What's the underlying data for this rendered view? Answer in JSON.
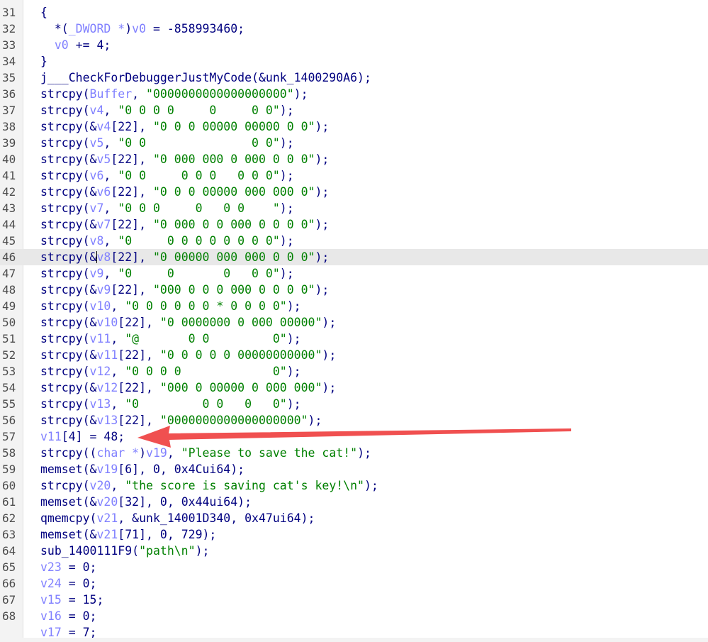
{
  "editor": {
    "highlight_line": 46,
    "caret_line": 46,
    "caret_col": 8,
    "lines": [
      {
        "n": "31",
        "t": [
          {
            "c": "punc",
            "s": "{"
          }
        ]
      },
      {
        "n": "32",
        "t": [
          {
            "c": "plain",
            "s": "  *("
          },
          {
            "c": "type",
            "s": "_DWORD *"
          },
          {
            "c": "plain",
            "s": ")"
          },
          {
            "c": "var",
            "s": "v0"
          },
          {
            "c": "plain",
            "s": " = -858993460;"
          }
        ]
      },
      {
        "n": "33",
        "t": [
          {
            "c": "var",
            "s": "  v0"
          },
          {
            "c": "plain",
            "s": " += 4;"
          }
        ]
      },
      {
        "n": "34",
        "t": [
          {
            "c": "punc",
            "s": "}"
          }
        ]
      },
      {
        "n": "35",
        "t": [
          {
            "c": "fn",
            "s": "j___CheckForDebuggerJustMyCode"
          },
          {
            "c": "plain",
            "s": "(&unk_1400290A6);"
          }
        ]
      },
      {
        "n": "36",
        "t": [
          {
            "c": "fn",
            "s": "strcpy"
          },
          {
            "c": "plain",
            "s": "("
          },
          {
            "c": "var",
            "s": "Buffer"
          },
          {
            "c": "plain",
            "s": ", "
          },
          {
            "c": "str",
            "s": "\"0000000000000000000\""
          },
          {
            "c": "plain",
            "s": ");"
          }
        ]
      },
      {
        "n": "37",
        "t": [
          {
            "c": "fn",
            "s": "strcpy"
          },
          {
            "c": "plain",
            "s": "("
          },
          {
            "c": "var",
            "s": "v4"
          },
          {
            "c": "plain",
            "s": ", "
          },
          {
            "c": "str",
            "s": "\"0 0 0 0     0     0 0\""
          },
          {
            "c": "plain",
            "s": ");"
          }
        ]
      },
      {
        "n": "38",
        "t": [
          {
            "c": "fn",
            "s": "strcpy"
          },
          {
            "c": "plain",
            "s": "(&"
          },
          {
            "c": "var",
            "s": "v4"
          },
          {
            "c": "plain",
            "s": "[22], "
          },
          {
            "c": "str",
            "s": "\"0 0 0 00000 00000 0 0\""
          },
          {
            "c": "plain",
            "s": ");"
          }
        ]
      },
      {
        "n": "39",
        "t": [
          {
            "c": "fn",
            "s": "strcpy"
          },
          {
            "c": "plain",
            "s": "("
          },
          {
            "c": "var",
            "s": "v5"
          },
          {
            "c": "plain",
            "s": ", "
          },
          {
            "c": "str",
            "s": "\"0 0               0 0\""
          },
          {
            "c": "plain",
            "s": ");"
          }
        ]
      },
      {
        "n": "40",
        "t": [
          {
            "c": "fn",
            "s": "strcpy"
          },
          {
            "c": "plain",
            "s": "(&"
          },
          {
            "c": "var",
            "s": "v5"
          },
          {
            "c": "plain",
            "s": "[22], "
          },
          {
            "c": "str",
            "s": "\"0 000 000 0 000 0 0 0\""
          },
          {
            "c": "plain",
            "s": ");"
          }
        ]
      },
      {
        "n": "41",
        "t": [
          {
            "c": "fn",
            "s": "strcpy"
          },
          {
            "c": "plain",
            "s": "("
          },
          {
            "c": "var",
            "s": "v6"
          },
          {
            "c": "plain",
            "s": ", "
          },
          {
            "c": "str",
            "s": "\"0 0     0 0 0   0 0 0\""
          },
          {
            "c": "plain",
            "s": ");"
          }
        ]
      },
      {
        "n": "42",
        "t": [
          {
            "c": "fn",
            "s": "strcpy"
          },
          {
            "c": "plain",
            "s": "(&"
          },
          {
            "c": "var",
            "s": "v6"
          },
          {
            "c": "plain",
            "s": "[22], "
          },
          {
            "c": "str",
            "s": "\"0 0 0 00000 000 000 0\""
          },
          {
            "c": "plain",
            "s": ");"
          }
        ]
      },
      {
        "n": "43",
        "t": [
          {
            "c": "fn",
            "s": "strcpy"
          },
          {
            "c": "plain",
            "s": "("
          },
          {
            "c": "var",
            "s": "v7"
          },
          {
            "c": "plain",
            "s": ", "
          },
          {
            "c": "str",
            "s": "\"0 0 0     0   0 0    \""
          },
          {
            "c": "plain",
            "s": ");"
          }
        ]
      },
      {
        "n": "44",
        "t": [
          {
            "c": "fn",
            "s": "strcpy"
          },
          {
            "c": "plain",
            "s": "(&"
          },
          {
            "c": "var",
            "s": "v7"
          },
          {
            "c": "plain",
            "s": "[22], "
          },
          {
            "c": "str",
            "s": "\"0 000 0 0 000 0 0 0 0\""
          },
          {
            "c": "plain",
            "s": ");"
          }
        ]
      },
      {
        "n": "45",
        "t": [
          {
            "c": "fn",
            "s": "strcpy"
          },
          {
            "c": "plain",
            "s": "("
          },
          {
            "c": "var",
            "s": "v8"
          },
          {
            "c": "plain",
            "s": ", "
          },
          {
            "c": "str",
            "s": "\"0     0 0 0 0 0 0 0 0\""
          },
          {
            "c": "plain",
            "s": ");"
          }
        ]
      },
      {
        "n": "46",
        "t": [
          {
            "c": "fn",
            "s": "strcpy"
          },
          {
            "c": "plain",
            "s": "(&"
          },
          {
            "c": "var",
            "s": "v8"
          },
          {
            "c": "plain",
            "s": "[22], "
          },
          {
            "c": "str",
            "s": "\"0 00000 000 000 0 0 0\""
          },
          {
            "c": "plain",
            "s": ");"
          }
        ]
      },
      {
        "n": "47",
        "t": [
          {
            "c": "fn",
            "s": "strcpy"
          },
          {
            "c": "plain",
            "s": "("
          },
          {
            "c": "var",
            "s": "v9"
          },
          {
            "c": "plain",
            "s": ", "
          },
          {
            "c": "str",
            "s": "\"0     0       0   0 0\""
          },
          {
            "c": "plain",
            "s": ");"
          }
        ]
      },
      {
        "n": "48",
        "t": [
          {
            "c": "fn",
            "s": "strcpy"
          },
          {
            "c": "plain",
            "s": "(&"
          },
          {
            "c": "var",
            "s": "v9"
          },
          {
            "c": "plain",
            "s": "[22], "
          },
          {
            "c": "str",
            "s": "\"000 0 0 0 000 0 0 0 0\""
          },
          {
            "c": "plain",
            "s": ");"
          }
        ]
      },
      {
        "n": "49",
        "t": [
          {
            "c": "fn",
            "s": "strcpy"
          },
          {
            "c": "plain",
            "s": "("
          },
          {
            "c": "var",
            "s": "v10"
          },
          {
            "c": "plain",
            "s": ", "
          },
          {
            "c": "str",
            "s": "\"0 0 0 0 0 0 * 0 0 0 0\""
          },
          {
            "c": "plain",
            "s": ");"
          }
        ]
      },
      {
        "n": "50",
        "t": [
          {
            "c": "fn",
            "s": "strcpy"
          },
          {
            "c": "plain",
            "s": "(&"
          },
          {
            "c": "var",
            "s": "v10"
          },
          {
            "c": "plain",
            "s": "[22], "
          },
          {
            "c": "str",
            "s": "\"0 0000000 0 000 00000\""
          },
          {
            "c": "plain",
            "s": ");"
          }
        ]
      },
      {
        "n": "51",
        "t": [
          {
            "c": "fn",
            "s": "strcpy"
          },
          {
            "c": "plain",
            "s": "("
          },
          {
            "c": "var",
            "s": "v11"
          },
          {
            "c": "plain",
            "s": ", "
          },
          {
            "c": "str",
            "s": "\"@       0 0         0\""
          },
          {
            "c": "plain",
            "s": ");"
          }
        ]
      },
      {
        "n": "52",
        "t": [
          {
            "c": "fn",
            "s": "strcpy"
          },
          {
            "c": "plain",
            "s": "(&"
          },
          {
            "c": "var",
            "s": "v11"
          },
          {
            "c": "plain",
            "s": "[22], "
          },
          {
            "c": "str",
            "s": "\"0 0 0 0 0 00000000000\""
          },
          {
            "c": "plain",
            "s": ");"
          }
        ]
      },
      {
        "n": "53",
        "t": [
          {
            "c": "fn",
            "s": "strcpy"
          },
          {
            "c": "plain",
            "s": "("
          },
          {
            "c": "var",
            "s": "v12"
          },
          {
            "c": "plain",
            "s": ", "
          },
          {
            "c": "str",
            "s": "\"0 0 0 0             0\""
          },
          {
            "c": "plain",
            "s": ");"
          }
        ]
      },
      {
        "n": "54",
        "t": [
          {
            "c": "fn",
            "s": "strcpy"
          },
          {
            "c": "plain",
            "s": "(&"
          },
          {
            "c": "var",
            "s": "v12"
          },
          {
            "c": "plain",
            "s": "[22], "
          },
          {
            "c": "str",
            "s": "\"000 0 00000 0 000 000\""
          },
          {
            "c": "plain",
            "s": ");"
          }
        ]
      },
      {
        "n": "55",
        "t": [
          {
            "c": "fn",
            "s": "strcpy"
          },
          {
            "c": "plain",
            "s": "("
          },
          {
            "c": "var",
            "s": "v13"
          },
          {
            "c": "plain",
            "s": ", "
          },
          {
            "c": "str",
            "s": "\"0         0 0   0   0\""
          },
          {
            "c": "plain",
            "s": ");"
          }
        ]
      },
      {
        "n": "56",
        "t": [
          {
            "c": "fn",
            "s": "strcpy"
          },
          {
            "c": "plain",
            "s": "(&"
          },
          {
            "c": "var",
            "s": "v13"
          },
          {
            "c": "plain",
            "s": "[22], "
          },
          {
            "c": "str",
            "s": "\"0000000000000000000\""
          },
          {
            "c": "plain",
            "s": ");"
          }
        ]
      },
      {
        "n": "57",
        "t": [
          {
            "c": "var",
            "s": "v11"
          },
          {
            "c": "plain",
            "s": "[4] = 48;"
          }
        ]
      },
      {
        "n": "58",
        "t": [
          {
            "c": "fn",
            "s": "strcpy"
          },
          {
            "c": "plain",
            "s": "(("
          },
          {
            "c": "type",
            "s": "char *"
          },
          {
            "c": "plain",
            "s": ")"
          },
          {
            "c": "var",
            "s": "v19"
          },
          {
            "c": "plain",
            "s": ", "
          },
          {
            "c": "str",
            "s": "\"Please to save the cat!\""
          },
          {
            "c": "plain",
            "s": ");"
          }
        ]
      },
      {
        "n": "59",
        "t": [
          {
            "c": "fn",
            "s": "memset"
          },
          {
            "c": "plain",
            "s": "(&"
          },
          {
            "c": "var",
            "s": "v19"
          },
          {
            "c": "plain",
            "s": "[6], 0, 0x4Cui64);"
          }
        ]
      },
      {
        "n": "60",
        "t": [
          {
            "c": "fn",
            "s": "strcpy"
          },
          {
            "c": "plain",
            "s": "("
          },
          {
            "c": "var",
            "s": "v20"
          },
          {
            "c": "plain",
            "s": ", "
          },
          {
            "c": "str",
            "s": "\"the score is saving cat's key!\\n\""
          },
          {
            "c": "plain",
            "s": ");"
          }
        ]
      },
      {
        "n": "61",
        "t": [
          {
            "c": "fn",
            "s": "memset"
          },
          {
            "c": "plain",
            "s": "(&"
          },
          {
            "c": "var",
            "s": "v20"
          },
          {
            "c": "plain",
            "s": "[32], 0, 0x44ui64);"
          }
        ]
      },
      {
        "n": "62",
        "t": [
          {
            "c": "fn",
            "s": "qmemcpy"
          },
          {
            "c": "plain",
            "s": "("
          },
          {
            "c": "var",
            "s": "v21"
          },
          {
            "c": "plain",
            "s": ", &unk_14001D340, 0x47ui64);"
          }
        ]
      },
      {
        "n": "63",
        "t": [
          {
            "c": "fn",
            "s": "memset"
          },
          {
            "c": "plain",
            "s": "(&"
          },
          {
            "c": "var",
            "s": "v21"
          },
          {
            "c": "plain",
            "s": "[71], 0, 729);"
          }
        ]
      },
      {
        "n": "64",
        "t": [
          {
            "c": "fn",
            "s": "sub_1400111F9"
          },
          {
            "c": "plain",
            "s": "("
          },
          {
            "c": "str",
            "s": "\"path\\n\""
          },
          {
            "c": "plain",
            "s": ");"
          }
        ]
      },
      {
        "n": "65",
        "t": [
          {
            "c": "var",
            "s": "v23"
          },
          {
            "c": "plain",
            "s": " = 0;"
          }
        ]
      },
      {
        "n": "66",
        "t": [
          {
            "c": "var",
            "s": "v24"
          },
          {
            "c": "plain",
            "s": " = 0;"
          }
        ]
      },
      {
        "n": "67",
        "t": [
          {
            "c": "var",
            "s": "v15"
          },
          {
            "c": "plain",
            "s": " = 15;"
          }
        ]
      },
      {
        "n": "68",
        "t": [
          {
            "c": "var",
            "s": "v16"
          },
          {
            "c": "plain",
            "s": " = 0;"
          }
        ]
      },
      {
        "n": "",
        "t": [
          {
            "c": "var",
            "s": "v17"
          },
          {
            "c": "plain",
            "s": " = 7;"
          }
        ]
      }
    ]
  },
  "annotation": {
    "type": "arrow",
    "color": "#f05050",
    "points_to_line": 57
  }
}
